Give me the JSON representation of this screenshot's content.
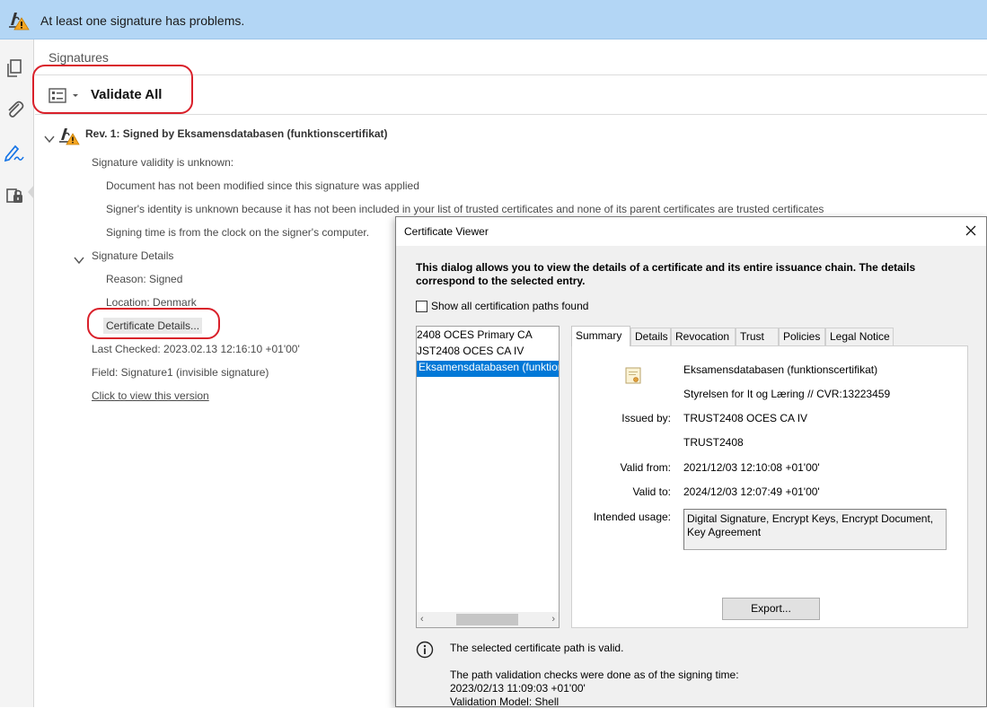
{
  "banner": {
    "icon": "signature-warning-icon",
    "message": "At least one signature has problems."
  },
  "left_toolbar": {
    "items": [
      {
        "icon": "pages-icon"
      },
      {
        "icon": "attachment-icon"
      },
      {
        "icon": "signature-pen-icon"
      },
      {
        "icon": "document-lock-icon"
      }
    ]
  },
  "signatures_panel": {
    "title": "Signatures",
    "validate_all_label": "Validate All",
    "revision": {
      "title": "Rev. 1: Signed by Eksamensdatabasen (funktionscertifikat)",
      "validity_heading": "Signature validity is unknown:",
      "validity_details": [
        "Document has not been modified since this signature was applied",
        "Signer's identity is unknown because it has not been included in your list of trusted certificates and none of its parent certificates are trusted certificates",
        "Signing time is from the clock on the signer's computer."
      ],
      "details_heading": "Signature Details",
      "reason": "Reason: Signed",
      "location": "Location: Denmark",
      "certificate_details_label": "Certificate Details...",
      "last_checked": "Last Checked: 2023.02.13 12:16:10 +01'00'",
      "field": "Field: Signature1 (invisible signature)",
      "view_version_link": "Click to view this version"
    }
  },
  "certificate_viewer": {
    "title": "Certificate Viewer",
    "description": "This dialog allows you to view the details of a certificate and its entire issuance chain. The details correspond to the selected entry.",
    "show_all_paths_label": "Show all certification paths found",
    "show_all_paths_checked": false,
    "chain": [
      {
        "label": "2408 OCES Primary CA",
        "selected": false
      },
      {
        "label": "JST2408 OCES CA IV",
        "selected": false
      },
      {
        "label": "Eksamensdatabasen (funktior",
        "selected": true
      }
    ],
    "tabs": [
      "Summary",
      "Details",
      "Revocation",
      "Trust",
      "Policies",
      "Legal Notice"
    ],
    "active_tab": "Summary",
    "summary": {
      "subject_name": "Eksamensdatabasen (funktionscertifikat)",
      "subject_org": "Styrelsen for It og Læring // CVR:13223459",
      "issued_by_label": "Issued by:",
      "issued_by": "TRUST2408 OCES CA IV",
      "issued_by_org": "TRUST2408",
      "valid_from_label": "Valid from:",
      "valid_from": "2021/12/03 12:10:08 +01'00'",
      "valid_to_label": "Valid to:",
      "valid_to": "2024/12/03 12:07:49 +01'00'",
      "intended_usage_label": "Intended usage:",
      "intended_usage": "Digital Signature, Encrypt Keys, Encrypt Document, Key Agreement",
      "export_label": "Export..."
    },
    "status": {
      "path_valid": "The selected certificate path is valid.",
      "checks_line": "The path validation checks were done as of the signing time:",
      "check_time": "2023/02/13 11:09:03 +01'00'",
      "validation_model": "Validation Model: Shell"
    }
  },
  "colors": {
    "banner_bg": "#b3d6f5",
    "highlight_oval": "#d9202a",
    "selection": "#0078d7",
    "warning": "#f5a623",
    "active_tool": "#1473e6"
  }
}
